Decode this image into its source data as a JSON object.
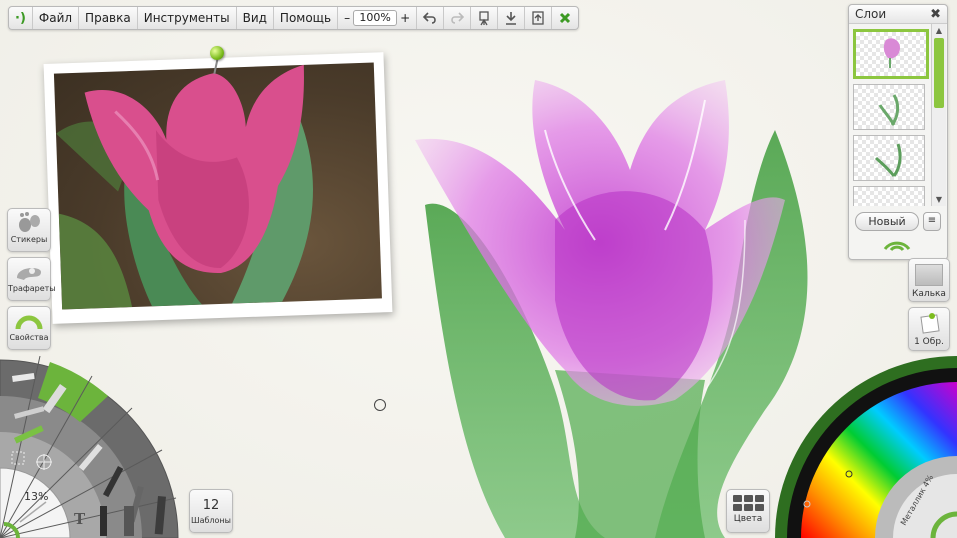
{
  "menu": {
    "items": [
      "Файл",
      "Правка",
      "Инструменты",
      "Вид",
      "Помощь"
    ],
    "zoom_minus": "–",
    "zoom_value": "100%",
    "zoom_plus": "+"
  },
  "left_tools": {
    "stickers": "Стикеры",
    "stencils": "Трафареты",
    "properties": "Свойства"
  },
  "brush_wheel": {
    "size_value": "13%"
  },
  "templates": {
    "count": "12",
    "label": "Шаблоны"
  },
  "colors_button": {
    "label": "Цвета"
  },
  "layers": {
    "title": "Слои",
    "close": "✖",
    "new_button": "Новый",
    "menu_button": "≡",
    "scroll_up": "▲",
    "scroll_down": "▼"
  },
  "right_tools": {
    "tracing": "Калька",
    "reference": "1 Обр."
  },
  "color_picker": {
    "label": "Металлик 4%"
  },
  "accent_color": "#8cc63f"
}
